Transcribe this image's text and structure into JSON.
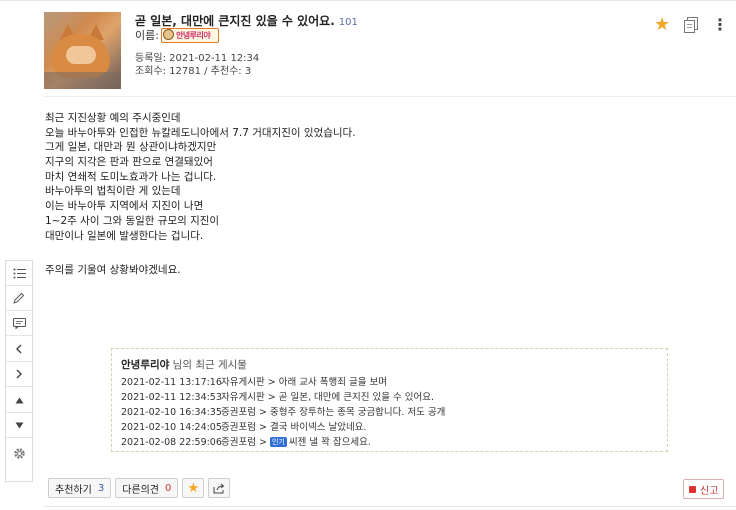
{
  "post": {
    "title": "곧 일본, 대만에 큰지진 있을 수 있어요.",
    "comment_count": "101",
    "name_label": "이름:",
    "nickname_icon_text": "안녕루리야",
    "registered": "등록일: 2021-02-11 12:34",
    "stats": "조회수: 12781 / 추천수: 3",
    "body_lines": [
      "최근 지진상황 예의 주시중인데",
      "오늘 바누아투와 인접한 뉴칼레도니아에서 7.7 거대지진이 있었습니다.",
      "그게 일본, 대만과 뭔 상관이냐하겠지만",
      "지구의 지각은 판과 판으로 연결돼있어",
      "마치 연쇄적 도미노효과가 나는 겁니다.",
      "바누아투의 법칙이란 게 있는데",
      "이는 바누아투 지역에서 지진이 나면",
      "1~2주 사이 그와 동일한 규모의 지진이",
      "대만이나 일본에 발생한다는 겁니다."
    ],
    "closing": "주의를 기울여 상황봐야겠네요."
  },
  "recent": {
    "author": "안녕루리야",
    "suffix": "님의 최근 게시물",
    "items": [
      {
        "date": "2021-02-11 13:17:16",
        "board": "자유게시판 >",
        "title": "아래 교사 폭행죄 글을 보며",
        "hot": ""
      },
      {
        "date": "2021-02-11 12:34:53",
        "board": "자유게시판 >",
        "title": "곧 일본, 대만에 큰지진 있을 수 있어요.",
        "hot": ""
      },
      {
        "date": "2021-02-10 16:34:35",
        "board": "증권포럼 >",
        "title": "중형주 장투하는 종목 궁금합니다. 저도 공개",
        "hot": ""
      },
      {
        "date": "2021-02-10 14:24:05",
        "board": "증권포럼 >",
        "title": "결국 바이넥스 날았네요.",
        "hot": ""
      },
      {
        "date": "2021-02-08 22:59:06",
        "board": "증권포럼 >",
        "title": "씨젠 낼 꽉 잡으세요.",
        "hot": "인기"
      }
    ]
  },
  "actions": {
    "recommend_label": "추천하기",
    "recommend_count": "3",
    "opinion_label": "다른의견",
    "opinion_count": "0",
    "report_label": "신고"
  },
  "icons": {
    "favorite": "star-icon",
    "copy": "copy-icon",
    "more": "more-vertical-icon",
    "share": "share-icon"
  },
  "colors": {
    "star": "#f5a623",
    "count_blue": "#3a5fb0",
    "count_red": "#dd3333",
    "hot_badge": "#2f6fd6"
  }
}
